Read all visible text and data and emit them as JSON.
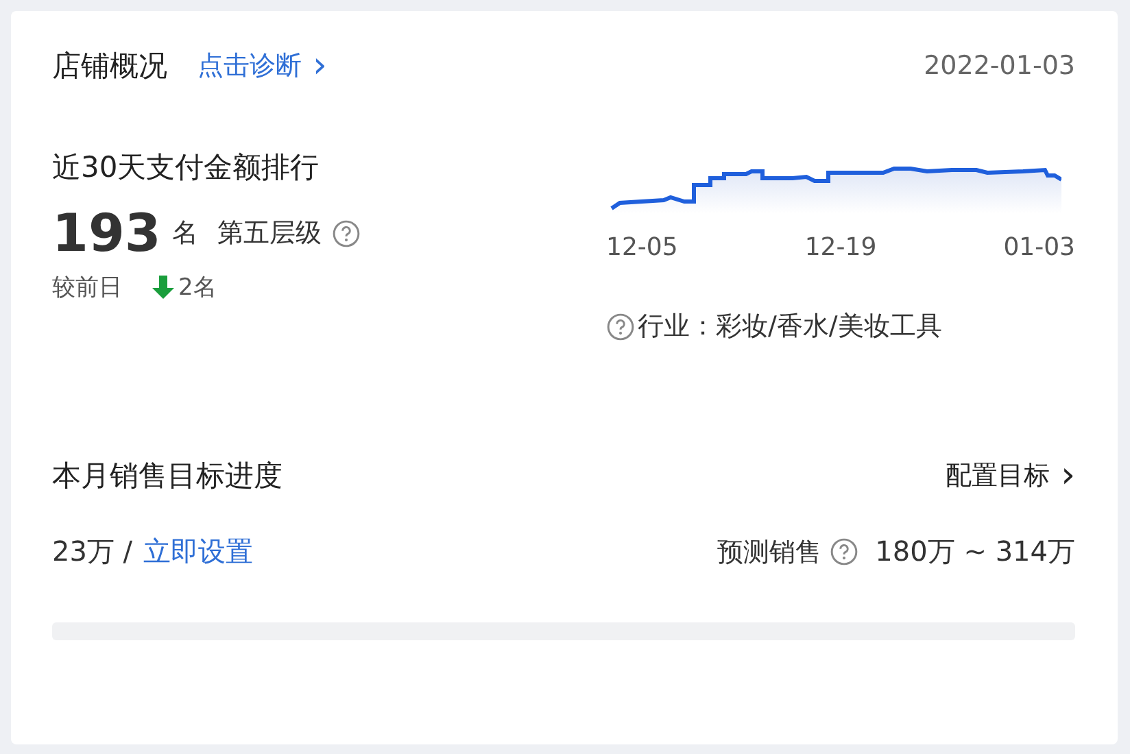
{
  "header": {
    "title": "店铺概况",
    "diagnose_link": "点击诊断",
    "chevron": "›",
    "date": "2022-01-03"
  },
  "ranking": {
    "title": "近30天支付金额排行",
    "rank": "193",
    "rank_unit": "名",
    "tier": "第五层级",
    "compare_label": "较前日",
    "falling": true,
    "change": "2名",
    "trend_axis_labels": [
      "12-05",
      "12-19",
      "01-03"
    ],
    "industry": "行业：彩妆/香水/美妆工具"
  },
  "sales_target": {
    "title": "本月销售目标进度",
    "configure_link": "配置目标",
    "chevron": "›",
    "current": "23万 /",
    "set_link": "立即设置",
    "forecast_label": "预测销售",
    "forecast_range": "180万 ~ 314万",
    "progress": {
      "level": 0
    }
  }
}
